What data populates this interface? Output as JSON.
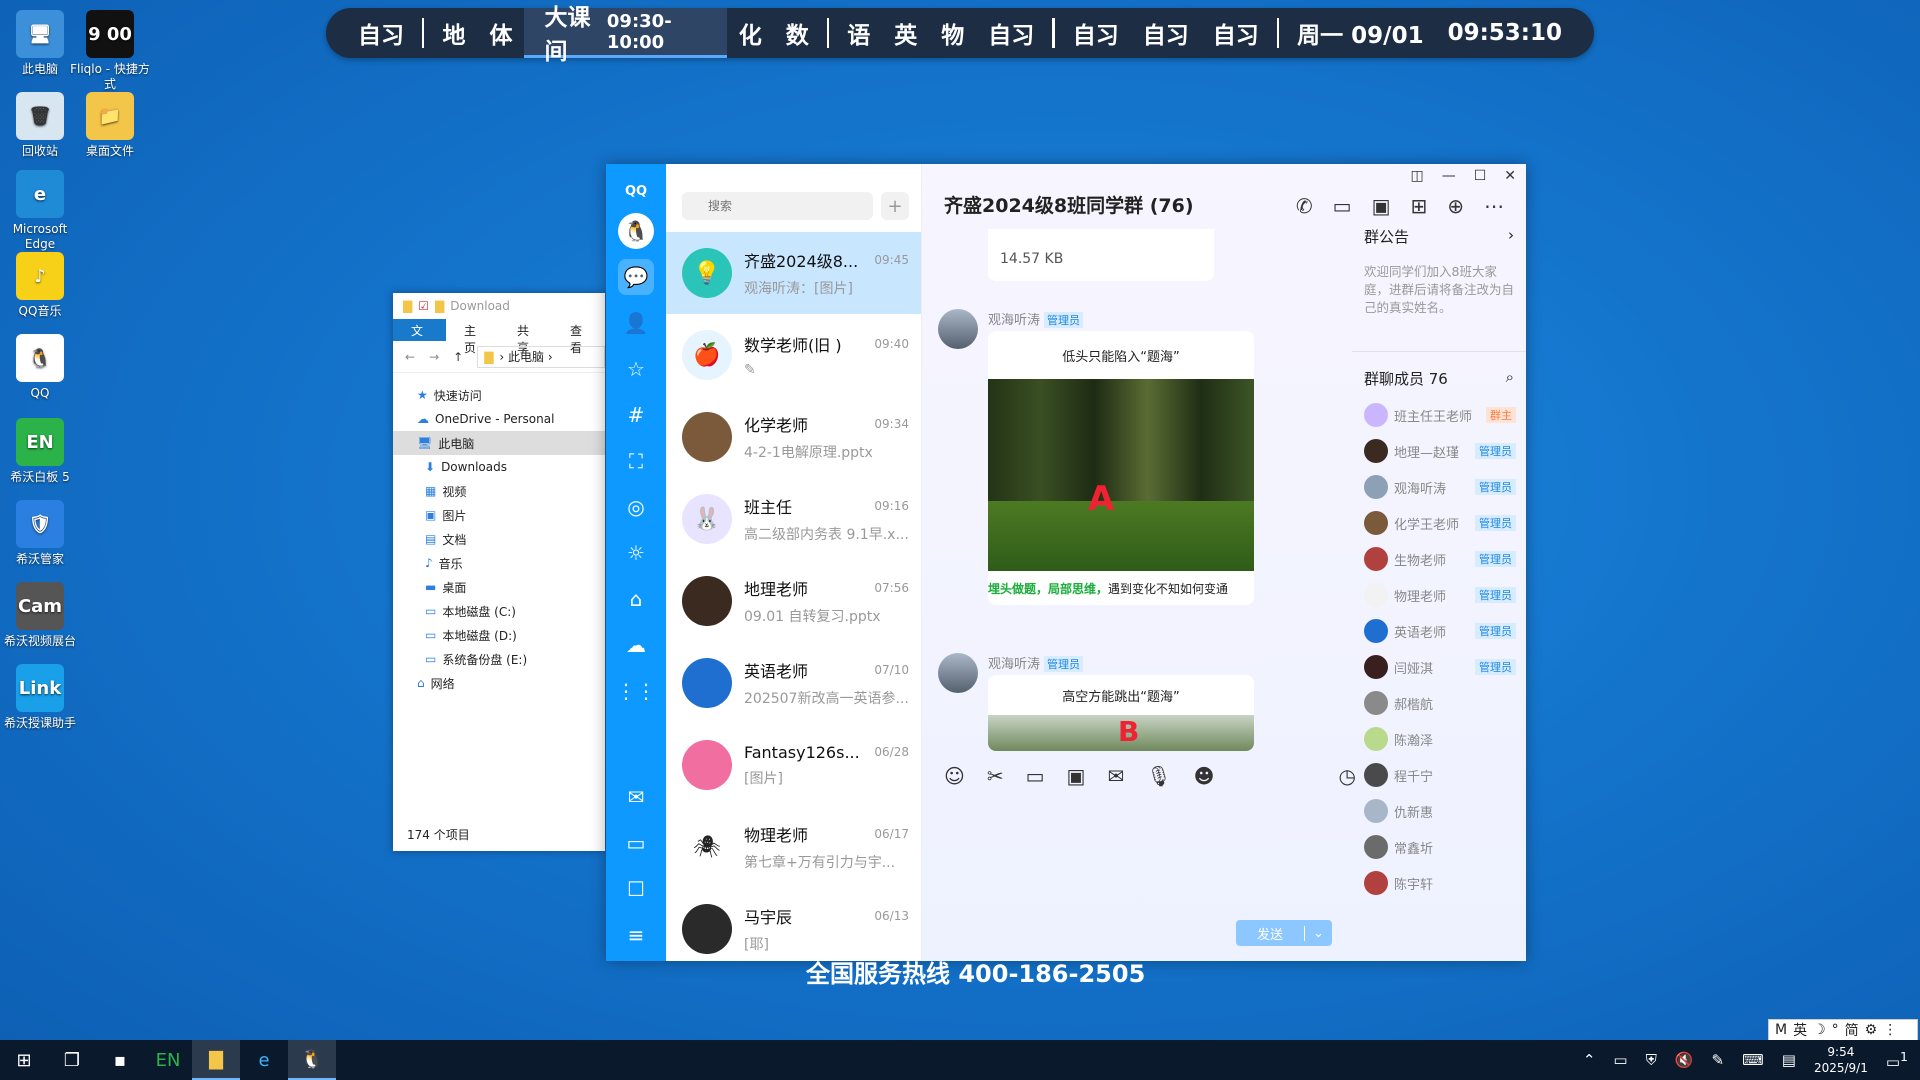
{
  "desktop_icons": [
    {
      "label": "此电脑",
      "color": "#3c8fd9",
      "glyph": "🖥"
    },
    {
      "label": "Fliqlo - 快捷方式",
      "color": "#111111",
      "glyph": "9 00"
    },
    {
      "label": "回收站",
      "color": "#d8e6f2",
      "glyph": "🗑"
    },
    {
      "label": "桌面文件",
      "color": "#f3c64a",
      "glyph": "📁"
    },
    {
      "label": "Microsoft Edge",
      "color": "#1f8ad6",
      "glyph": "e"
    },
    {
      "label": "QQ音乐",
      "color": "#f7d117",
      "glyph": "♪"
    },
    {
      "label": "QQ",
      "color": "#ffffff",
      "glyph": "🐧"
    },
    {
      "label": "希沃白板 5",
      "color": "#2bb34a",
      "glyph": "EN"
    },
    {
      "label": "希沃管家",
      "color": "#2a7fe0",
      "glyph": "🛡"
    },
    {
      "label": "希沃视频展台",
      "color": "#555555",
      "glyph": "Cam"
    },
    {
      "label": "希沃授课助手",
      "color": "#1aa0e8",
      "glyph": "Link"
    }
  ],
  "schedule": {
    "items1": [
      "自习"
    ],
    "items2": [
      "地",
      "体"
    ],
    "current": "大课间",
    "current_time": "09:30-10:00",
    "items3": [
      "化",
      "数"
    ],
    "items4": [
      "语",
      "英",
      "物",
      "自习"
    ],
    "items5": [
      "自习",
      "自习",
      "自习"
    ],
    "date": "周一 09/01",
    "clock": "09:53:10"
  },
  "explorer": {
    "title": "Download",
    "tabs": [
      "文件",
      "主页",
      "共享",
      "查看"
    ],
    "path": "此电脑",
    "tree": [
      {
        "label": "快速访问",
        "icon": "★",
        "sub": false,
        "sel": false
      },
      {
        "label": "OneDrive - Personal",
        "icon": "☁",
        "sub": false,
        "sel": false
      },
      {
        "label": "此电脑",
        "icon": "🖥",
        "sub": false,
        "sel": true
      },
      {
        "label": "Downloads",
        "icon": "⬇",
        "sub": true,
        "sel": false
      },
      {
        "label": "视频",
        "icon": "▦",
        "sub": true,
        "sel": false
      },
      {
        "label": "图片",
        "icon": "▣",
        "sub": true,
        "sel": false
      },
      {
        "label": "文档",
        "icon": "▤",
        "sub": true,
        "sel": false
      },
      {
        "label": "音乐",
        "icon": "♪",
        "sub": true,
        "sel": false
      },
      {
        "label": "桌面",
        "icon": "▬",
        "sub": true,
        "sel": false
      },
      {
        "label": "本地磁盘 (C:)",
        "icon": "▭",
        "sub": true,
        "sel": false
      },
      {
        "label": "本地磁盘 (D:)",
        "icon": "▭",
        "sub": true,
        "sel": false
      },
      {
        "label": "系统备份盘 (E:)",
        "icon": "▭",
        "sub": true,
        "sel": false
      },
      {
        "label": "网络",
        "icon": "⌂",
        "sub": false,
        "sel": false
      }
    ],
    "status": "174 个项目"
  },
  "qq": {
    "logo": "QQ",
    "search_placeholder": "搜索",
    "conversations": [
      {
        "name": "齐盛2024级8...",
        "time": "09:45",
        "msg": "观海听涛：[图片]",
        "color": "#2bc4b8",
        "glyph": "💡",
        "active": true
      },
      {
        "name": "数学老师(旧 )",
        "time": "09:40",
        "msg": "✎",
        "color": "#e6f4ff",
        "glyph": "🍎",
        "active": false
      },
      {
        "name": "化学老师",
        "time": "09:34",
        "msg": "4-2-1电解原理.pptx",
        "color": "#7a5a3a",
        "glyph": "",
        "active": false
      },
      {
        "name": "班主任",
        "time": "09:16",
        "msg": "高二级部内务表 9.1早.x...",
        "color": "#e8e4ff",
        "glyph": "🐰",
        "active": false
      },
      {
        "name": "地理老师",
        "time": "07:56",
        "msg": "09.01 自转复习.pptx",
        "color": "#3a2a20",
        "glyph": "",
        "active": false
      },
      {
        "name": "英语老师",
        "time": "07/10",
        "msg": "202507新改高一英语参...",
        "color": "#1f6fd0",
        "glyph": "",
        "active": false
      },
      {
        "name": "Fantasy126s...",
        "time": "06/28",
        "msg": "[图片]",
        "color": "#f06ea0",
        "glyph": "",
        "active": false
      },
      {
        "name": "物理老师",
        "time": "06/17",
        "msg": "第七章+万有引力与宇...",
        "color": "#ffffff",
        "glyph": "🕷",
        "active": false
      },
      {
        "name": "马宇辰",
        "time": "06/13",
        "msg": "[耶]",
        "color": "#2a2a2a",
        "glyph": "",
        "active": false
      }
    ],
    "chat_title": "齐盛2024级8班同学群 (76)",
    "file_size": "14.57 KB",
    "messages": [
      {
        "sender": "观海听涛",
        "role": "管理员",
        "caption": "低头只能陷入“题海”",
        "letter": "A",
        "footer_green": "埋头做题，局部思维，",
        "footer_rest": "遇到变化不知如何变通"
      },
      {
        "sender": "观海听涛",
        "role": "管理员",
        "caption": "高空方能跳出“题海”",
        "letter": "B"
      }
    ],
    "send_label": "发送",
    "notice_title": "群公告",
    "notice_text": "欢迎同学们加入8班大家庭，进群后请将备注改为自己的真实姓名。",
    "members_title": "群聊成员 76",
    "members": [
      {
        "name": "班主任王老师",
        "tag": "群主",
        "color": "#c9b6ff"
      },
      {
        "name": "地理—赵瑾",
        "tag": "管理员",
        "color": "#3a2a20"
      },
      {
        "name": "观海听涛",
        "tag": "管理员",
        "color": "#8ea0b6"
      },
      {
        "name": "化学王老师",
        "tag": "管理员",
        "color": "#7a5a3a"
      },
      {
        "name": "生物老师",
        "tag": "管理员",
        "color": "#b0413e"
      },
      {
        "name": "物理老师",
        "tag": "管理员",
        "color": "#f2f2f2"
      },
      {
        "name": "英语老师",
        "tag": "管理员",
        "color": "#1f6fd0"
      },
      {
        "name": "闫娅淇",
        "tag": "管理员",
        "color": "#3a1f1f"
      },
      {
        "name": "郝楷航",
        "tag": "",
        "color": "#8a8a8a"
      },
      {
        "name": "陈瀚泽",
        "tag": "",
        "color": "#b9d98c"
      },
      {
        "name": "程千宁",
        "tag": "",
        "color": "#4a4a4a"
      },
      {
        "name": "仇新惠",
        "tag": "",
        "color": "#a7b6c9"
      },
      {
        "name": "常鑫圻",
        "tag": "",
        "color": "#6b6b6b"
      },
      {
        "name": "陈宇轩",
        "tag": "",
        "color": "#b0413e"
      }
    ]
  },
  "hotline": "全国服务热线 400-186-2505",
  "ime": [
    "M",
    "英",
    "☽",
    "°",
    "简",
    "⚙",
    "⋮"
  ],
  "taskbar": {
    "time": "9:54",
    "date": "2025/9/1",
    "notif": "1"
  }
}
